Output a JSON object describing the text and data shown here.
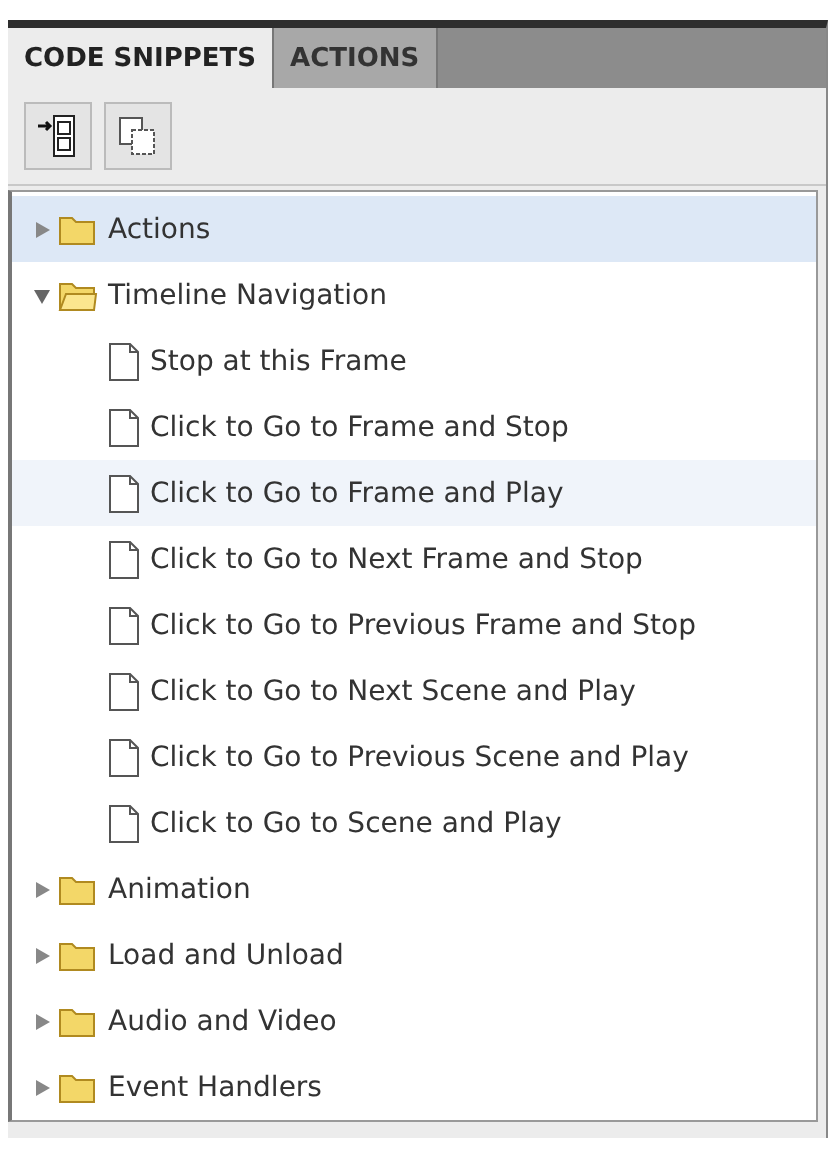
{
  "tabs": [
    {
      "label": "CODE SNIPPETS",
      "selected": true
    },
    {
      "label": "ACTIONS",
      "selected": false
    }
  ],
  "toolbar": [
    {
      "kind": "add"
    },
    {
      "kind": "copy"
    }
  ],
  "tree": [
    {
      "label": "Actions",
      "expanded": false,
      "selected": true,
      "hovered": false
    },
    {
      "label": "Timeline Navigation",
      "expanded": true,
      "selected": false,
      "hovered": false,
      "children": [
        {
          "label": "Stop at this Frame",
          "selected": false,
          "hovered": false
        },
        {
          "label": "Click to Go to Frame and Stop",
          "selected": false,
          "hovered": false
        },
        {
          "label": "Click to Go to Frame and Play",
          "selected": false,
          "hovered": true
        },
        {
          "label": "Click to Go to Next Frame and Stop",
          "selected": false,
          "hovered": false
        },
        {
          "label": "Click to Go to Previous Frame and Stop",
          "selected": false,
          "hovered": false
        },
        {
          "label": "Click to Go to Next Scene and Play",
          "selected": false,
          "hovered": false
        },
        {
          "label": "Click to Go to Previous Scene and Play",
          "selected": false,
          "hovered": false
        },
        {
          "label": "Click to Go to Scene and Play",
          "selected": false,
          "hovered": false
        }
      ]
    },
    {
      "label": "Animation",
      "expanded": false,
      "selected": false,
      "hovered": false
    },
    {
      "label": "Load and Unload",
      "expanded": false,
      "selected": false,
      "hovered": false
    },
    {
      "label": "Audio and Video",
      "expanded": false,
      "selected": false,
      "hovered": false
    },
    {
      "label": "Event Handlers",
      "expanded": false,
      "selected": false,
      "hovered": false
    }
  ]
}
